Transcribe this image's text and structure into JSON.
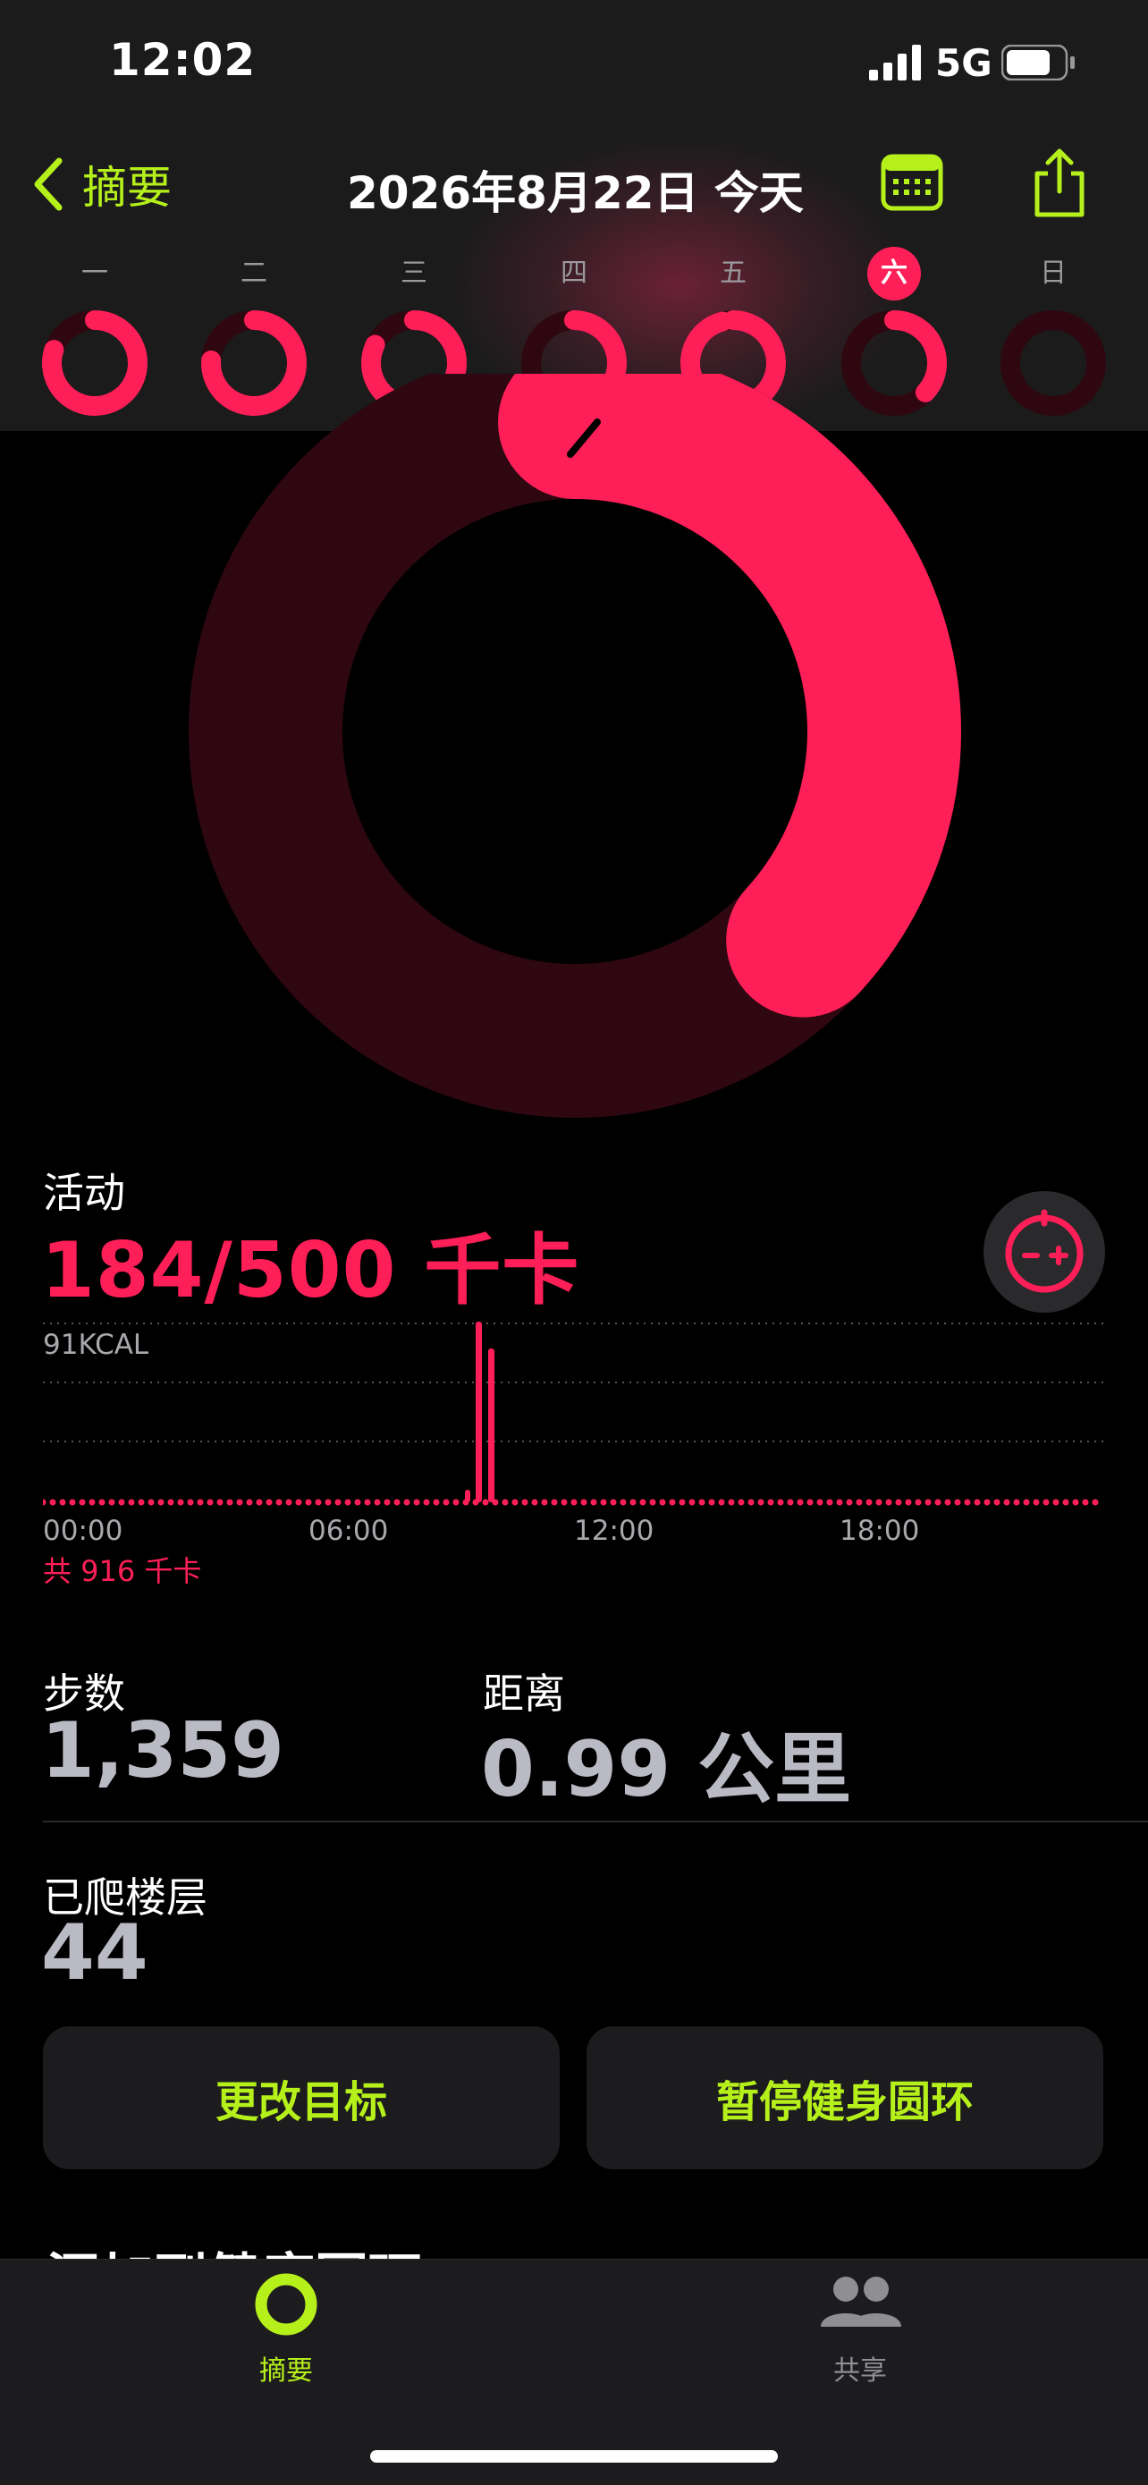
{
  "status_bar": {
    "time": "12:02",
    "network": "5G"
  },
  "nav": {
    "back_label": "摘要",
    "title": "2026年8月22日 今天"
  },
  "week": {
    "days": [
      {
        "label": "一",
        "progress": 0.8
      },
      {
        "label": "二",
        "progress": 0.76
      },
      {
        "label": "三",
        "progress": 0.82
      },
      {
        "label": "四",
        "progress": 0.55
      },
      {
        "label": "五",
        "progress": 0.96
      },
      {
        "label": "六",
        "progress": 0.37,
        "selected": true
      },
      {
        "label": "日",
        "progress": 0.0
      }
    ]
  },
  "activity": {
    "title": "活动",
    "value": "184/500 千卡",
    "progress": 0.368,
    "chart_max_label": "91KCAL",
    "time_labels": [
      "00:00",
      "06:00",
      "12:00",
      "18:00"
    ],
    "total": "共 916 千卡"
  },
  "stats": {
    "steps_label": "步数",
    "steps_value": "1,359",
    "distance_label": "距离",
    "distance_value": "0.99 公里",
    "floors_label": "已爬楼层",
    "floors_value": "44"
  },
  "buttons": {
    "change_goal": "更改目标",
    "pause_rings": "暂停健身圆环"
  },
  "next_section_title": "添加到健康圆环",
  "tabs": {
    "summary": "摘要",
    "sharing": "共享"
  },
  "colors": {
    "accent": "#b6f01b",
    "move": "#ff1f58",
    "move_track": "#2e0711"
  }
}
